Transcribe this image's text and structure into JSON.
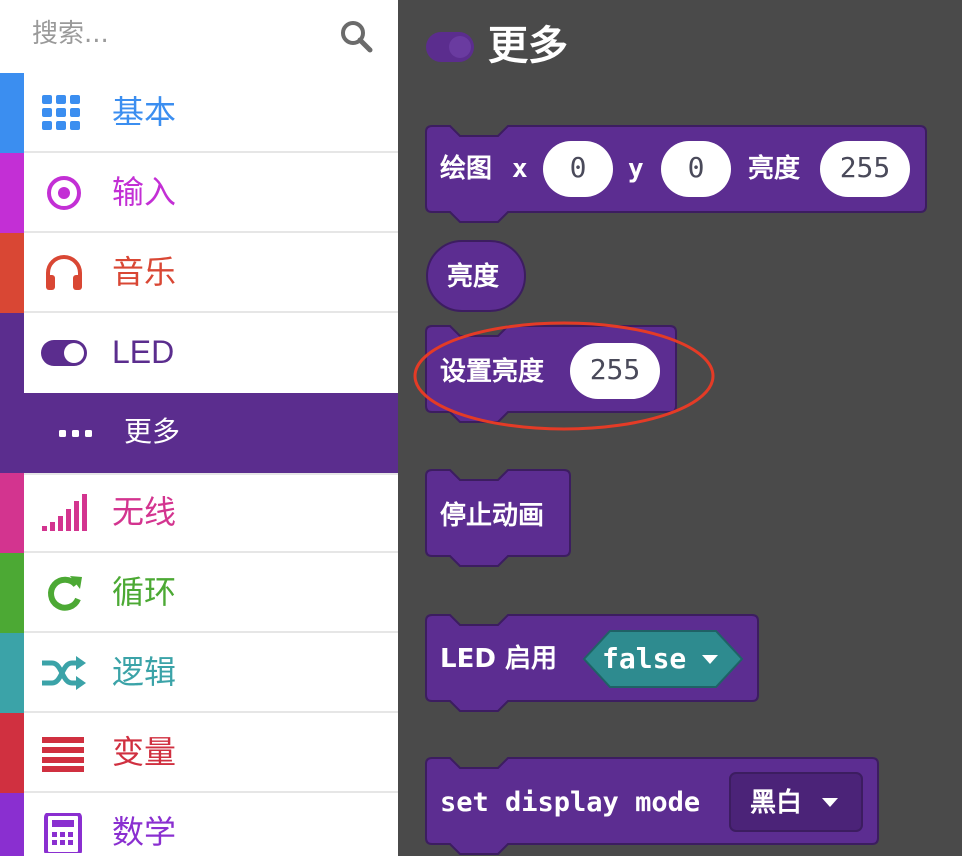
{
  "search": {
    "placeholder": "搜索..."
  },
  "categories": [
    {
      "label": "基本",
      "color": "#1e90ff",
      "icon": "grid-icon"
    },
    {
      "label": "输入",
      "color": "#d400d4",
      "icon": "target-icon"
    },
    {
      "label": "音乐",
      "color": "#e63022",
      "icon": "headphones-icon"
    },
    {
      "label": "LED",
      "color": "#5c2d91",
      "icon": "toggle-icon"
    },
    {
      "label": "更多",
      "color": "#5c2d91",
      "icon": "ellipsis-icon"
    },
    {
      "label": "无线",
      "color": "#e3008c",
      "icon": "signal-icon"
    },
    {
      "label": "循环",
      "color": "#00aa00",
      "icon": "refresh-icon"
    },
    {
      "label": "逻辑",
      "color": "#00a4a6",
      "icon": "shuffle-icon"
    },
    {
      "label": "变量",
      "color": "#dc143c",
      "icon": "list-icon"
    },
    {
      "label": "数学",
      "color": "#9400d3",
      "icon": "calculator-icon"
    }
  ],
  "flyout": {
    "title": "更多",
    "blocks": {
      "plot": {
        "label": "绘图",
        "x_label": "x",
        "x_value": "0",
        "y_label": "y",
        "y_value": "0",
        "brightness_label": "亮度",
        "brightness_value": "255"
      },
      "brightness": {
        "label": "亮度"
      },
      "set_brightness": {
        "label": "设置亮度",
        "value": "255"
      },
      "stop_animation": {
        "label": "停止动画"
      },
      "led_enable": {
        "label": "LED 启用",
        "value": "false"
      },
      "display_mode": {
        "label": "set display mode",
        "value": "黑白"
      }
    }
  },
  "colors": {
    "block": "#5c2d91",
    "block_border": "#3c1d60",
    "logic": "#00929b",
    "annotation": "#e43b26",
    "workspace": "#4a4a4a"
  }
}
